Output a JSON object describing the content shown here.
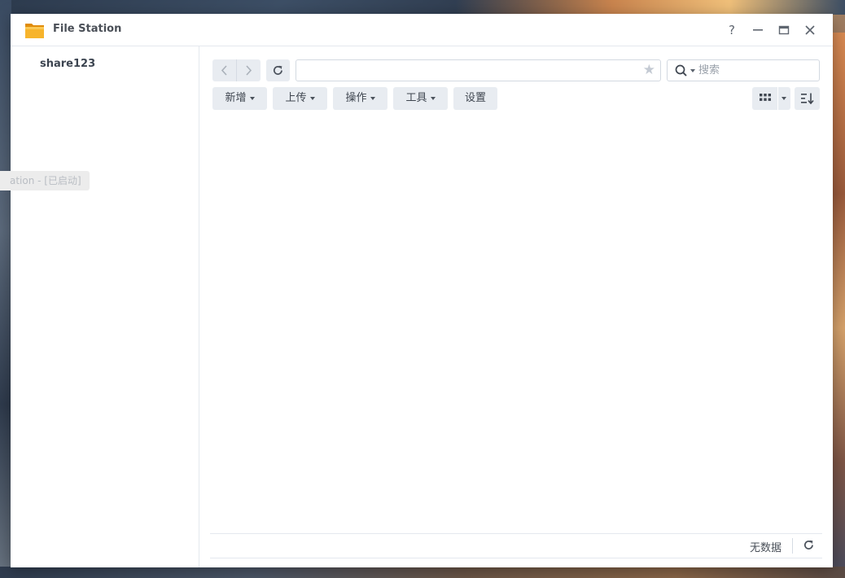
{
  "window": {
    "title": "File Station",
    "help_label": "?",
    "minimize_label": "–",
    "close_label": "✕"
  },
  "sidebar": {
    "items": [
      {
        "label": "share123"
      }
    ]
  },
  "tooltip": {
    "text": "ation - [已启动]"
  },
  "toolbar": {
    "path_value": "",
    "search_placeholder": "搜索",
    "buttons": [
      {
        "label": "新增",
        "has_dropdown": true
      },
      {
        "label": "上传",
        "has_dropdown": true
      },
      {
        "label": "操作",
        "has_dropdown": true
      },
      {
        "label": "工具",
        "has_dropdown": true
      },
      {
        "label": "设置",
        "has_dropdown": false
      }
    ],
    "view_mode": "grid-icon",
    "favorite_icon": "star-icon"
  },
  "status": {
    "text": "无数据"
  },
  "colors": {
    "folder": "#f5a623",
    "button_bg": "#e8ecf1",
    "title_text": "#4a4f57",
    "border": "#e4e8ee"
  }
}
